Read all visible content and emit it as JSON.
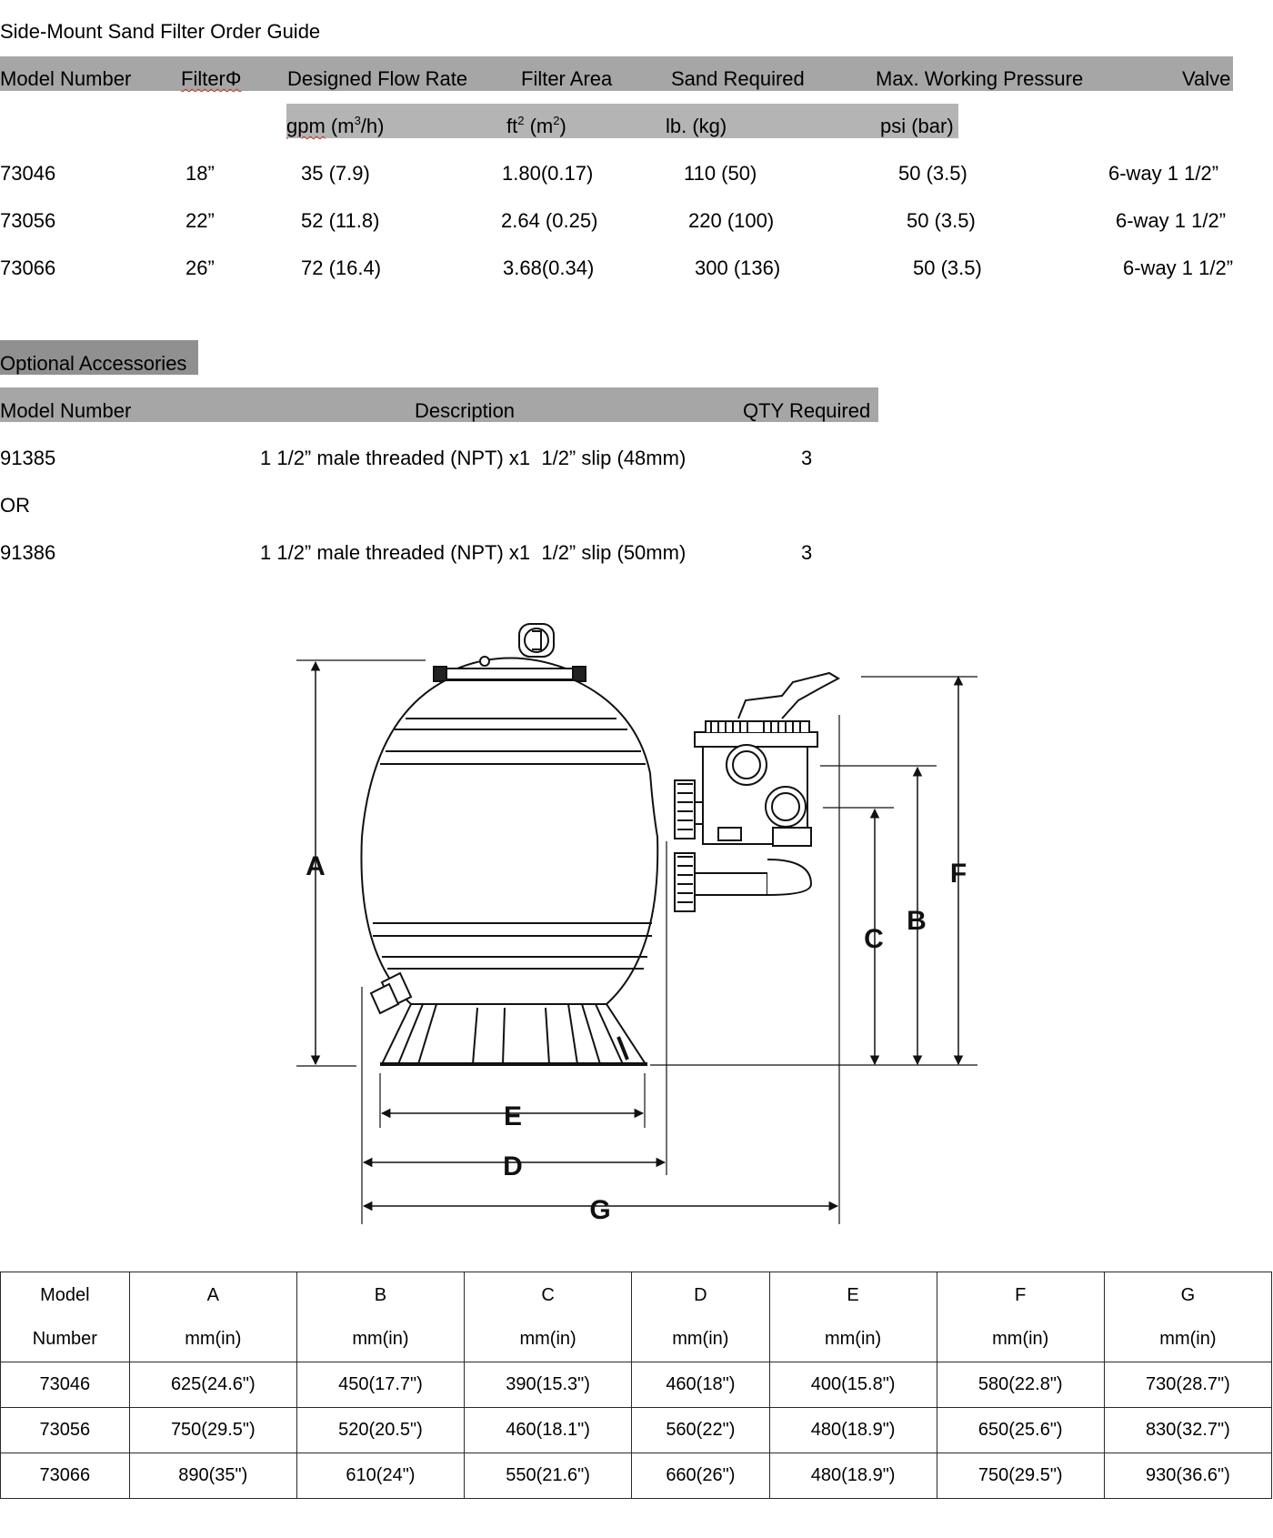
{
  "title": "Side-Mount Sand Filter Order Guide",
  "order_table": {
    "headers": [
      "Model Number",
      "FilterΦ",
      "Designed Flow Rate",
      "Filter Area",
      "Sand Required",
      "Max. Working Pressure",
      "Valve"
    ],
    "units": {
      "flow": "gpm (m³/h)",
      "area_pre": "ft",
      "area_sup": "2",
      "area_mid": " (m",
      "area_sup2": "2",
      "area_post": ")",
      "sand": "lb. (kg)",
      "pressure": "psi (bar)"
    },
    "rows": [
      {
        "model": "73046",
        "filter": "18”",
        "flow": "35 (7.9)",
        "area": "1.80(0.17)",
        "sand": "110 (50)",
        "pressure": "50 (3.5)",
        "valve": "6-way 1 1/2”"
      },
      {
        "model": "73056",
        "filter": "22”",
        "flow": "52 (11.8)",
        "area": "2.64 (0.25)",
        "sand": "220 (100)",
        "pressure": "50 (3.5)",
        "valve": "6-way 1 1/2”"
      },
      {
        "model": "73066",
        "filter": "26”",
        "flow": "72 (16.4)",
        "area": "3.68(0.34)",
        "sand": "300 (136)",
        "pressure": "50 (3.5)",
        "valve": "6-way 1 1/2”"
      }
    ]
  },
  "accessories": {
    "title": "Optional Accessories",
    "headers": [
      "Model Number",
      "Description",
      "QTY Required"
    ],
    "rows": [
      {
        "model": "91385",
        "description": "1 1/2” male threaded (NPT) x1  1/2” slip (48mm)",
        "qty": "3"
      },
      {
        "separator": "OR"
      },
      {
        "model": "91386",
        "description": "1 1/2” male threaded (NPT) x1  1/2” slip (50mm)",
        "qty": "3"
      }
    ]
  },
  "diagram": {
    "labels": [
      "A",
      "B",
      "C",
      "D",
      "E",
      "F",
      "G"
    ]
  },
  "dimension_table": {
    "header_top": [
      "Model",
      "A",
      "B",
      "C",
      "D",
      "E",
      "F",
      "G"
    ],
    "header_bottom": [
      "Number",
      "mm(in)",
      "mm(in)",
      "mm(in)",
      "mm(in)",
      "mm(in)",
      "mm(in)",
      "mm(in)"
    ],
    "rows": [
      [
        "73046",
        "625(24.6\")",
        "450(17.7\")",
        "390(15.3\")",
        "460(18\")",
        "400(15.8\")",
        "580(22.8\")",
        "730(28.7\")"
      ],
      [
        "73056",
        "750(29.5\")",
        "520(20.5\")",
        "460(18.1\")",
        "560(22\")",
        "480(18.9\")",
        "650(25.6\")",
        "830(32.7\")"
      ],
      [
        "73066",
        "890(35\")",
        "610(24\")",
        "550(21.6\")",
        "660(26\")",
        "480(18.9\")",
        "750(29.5\")",
        "930(36.6\")"
      ]
    ]
  }
}
